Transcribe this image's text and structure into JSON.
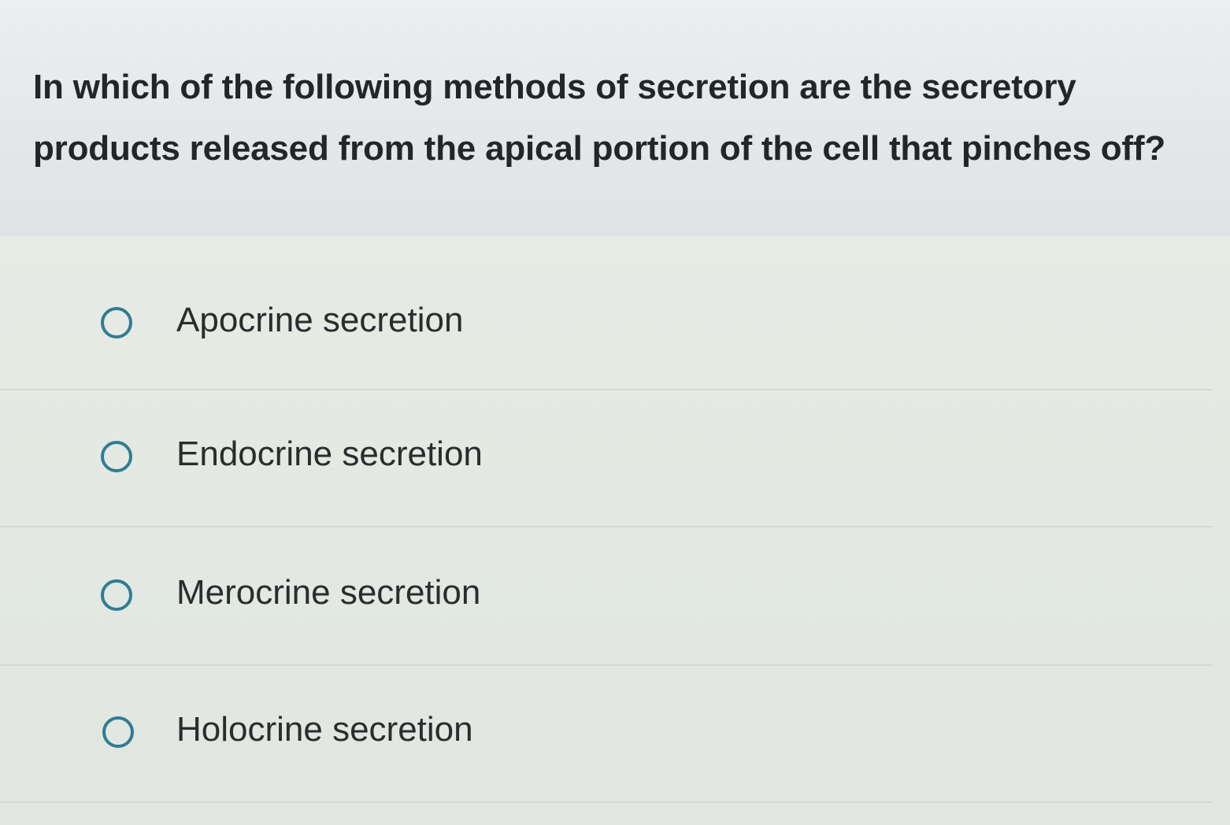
{
  "question": {
    "text": "In which of the following methods of secretion are the secretory products released from the apical portion of the cell that pinches off?"
  },
  "options": [
    {
      "label": "Apocrine secretion",
      "selected": false
    },
    {
      "label": "Endocrine secretion",
      "selected": false
    },
    {
      "label": "Merocrine secretion",
      "selected": false
    },
    {
      "label": "Holocrine secretion",
      "selected": false
    }
  ],
  "colors": {
    "radio_border": "#2f7d92",
    "question_text": "#232628",
    "option_text": "#2a2c2e"
  },
  "icons": {
    "radio": "radio-unchecked-icon"
  }
}
